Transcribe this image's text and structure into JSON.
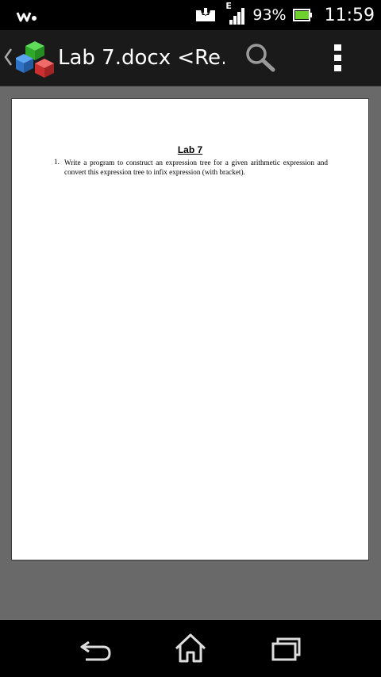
{
  "status_bar": {
    "network_type": "E",
    "battery_percent": "93%",
    "time": "11:59"
  },
  "action_bar": {
    "title": "Lab 7.docx <Re…"
  },
  "document": {
    "heading": "Lab 7",
    "items": [
      {
        "number": "1.",
        "text": "Write a program to construct an expression tree for a given arithmetic expression and convert this expression tree to infix expression (with bracket)."
      }
    ]
  },
  "icons": {
    "status_left": "walkman-icon",
    "status_notify": "download-box-icon",
    "signal": "signal-icon",
    "battery": "battery-icon",
    "app": "app-logo-cubes-icon",
    "search": "search-icon",
    "overflow": "more-vert-icon",
    "nav_back": "back-icon",
    "nav_home": "home-icon",
    "nav_recent": "recent-apps-icon"
  },
  "colors": {
    "status_bar_bg": "#000000",
    "action_bar_bg": "#1a1a1a",
    "viewer_bg": "#696969",
    "page_bg": "#ffffff",
    "battery_fill": "#6fd12e"
  }
}
